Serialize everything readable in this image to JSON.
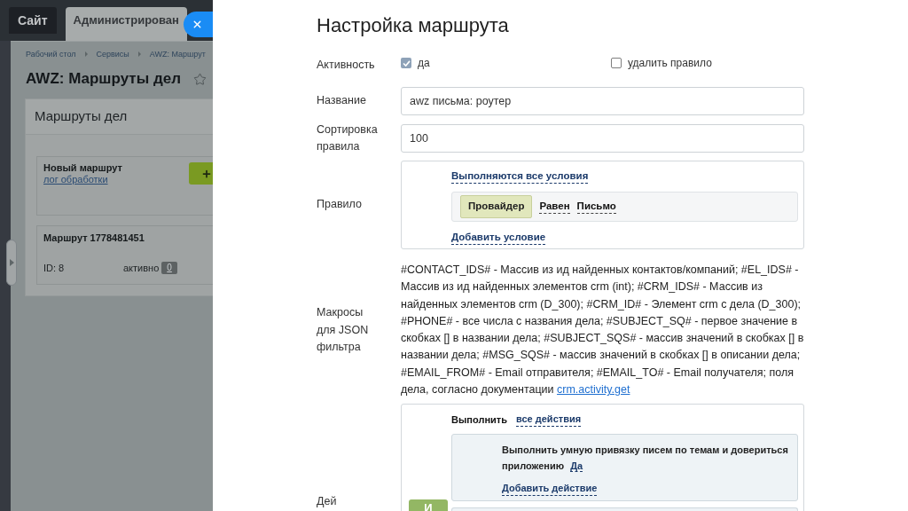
{
  "background_page": {
    "tabs": [
      {
        "label": "Сайт",
        "selected": false
      },
      {
        "label": "Администрирован",
        "selected": true
      }
    ],
    "breadcrumbs": [
      "Рабочий стол",
      "Сервисы",
      "AWZ: Маршрут"
    ],
    "title": "AWZ: Маршруты дел",
    "panel": {
      "title": "Маршруты дел",
      "routes": [
        {
          "kind": "new",
          "name": "Новый маршрут",
          "link": "лог обработки"
        },
        {
          "kind": "route",
          "name": "Маршрут 1778481451",
          "id": "ID: 8",
          "status": "активно",
          "count": "0"
        }
      ]
    }
  },
  "slider": {
    "title": "Настройка маршрута",
    "fields": [
      {
        "kind": "checkboxes",
        "label": "Активность",
        "options": [
          {
            "label": "да",
            "checked": true
          },
          {
            "label": "удалить правило",
            "checked": false
          }
        ]
      },
      {
        "kind": "input",
        "label": "Название",
        "value": "awz письма: роутер"
      },
      {
        "kind": "input",
        "label": "Сортировка правила",
        "value": "100"
      },
      {
        "kind": "rule",
        "label": "Правило",
        "mode": "Выполняются все условия",
        "conditions": [
          {
            "field": "Провайдер",
            "operator": "Равен",
            "value": "Письмо"
          }
        ],
        "add_link": "Добавить условие"
      },
      {
        "kind": "text",
        "label": "Макросы для JSON фильтра",
        "text": "#CONTACT_IDS# - Массив из ид найденных контактов/компаний; #EL_IDS# - Массив из ид найденных элементов crm (int); #CRM_IDS# - Массив из найденных элементов crm (D_300); #CRM_ID# - Элемент crm с дела (D_300); #PHONE# - все числа с названия дела; #SUBJECT_SQ# - первое значение в скобках [] в названии дела; #SUBJECT_SQS# - массив значений в скобках [] в названии дела; #MSG_SQS# - массив значений в скобках [] в описании дела; #EMAIL_FROM# - Email отправителя; #EMAIL_TO# - Email получателя; поля дела, согласно документации",
        "link": "crm.activity.get"
      },
      {
        "kind": "actions",
        "label": "Дей",
        "prefix": "Выполнить",
        "mode": "все действия",
        "actions": [
          {
            "text": "Выполнить умную привязку писем по темам и довериться приложению",
            "value": "Да"
          }
        ],
        "add_link": "Добавить действие",
        "joiner": "И"
      }
    ]
  }
}
